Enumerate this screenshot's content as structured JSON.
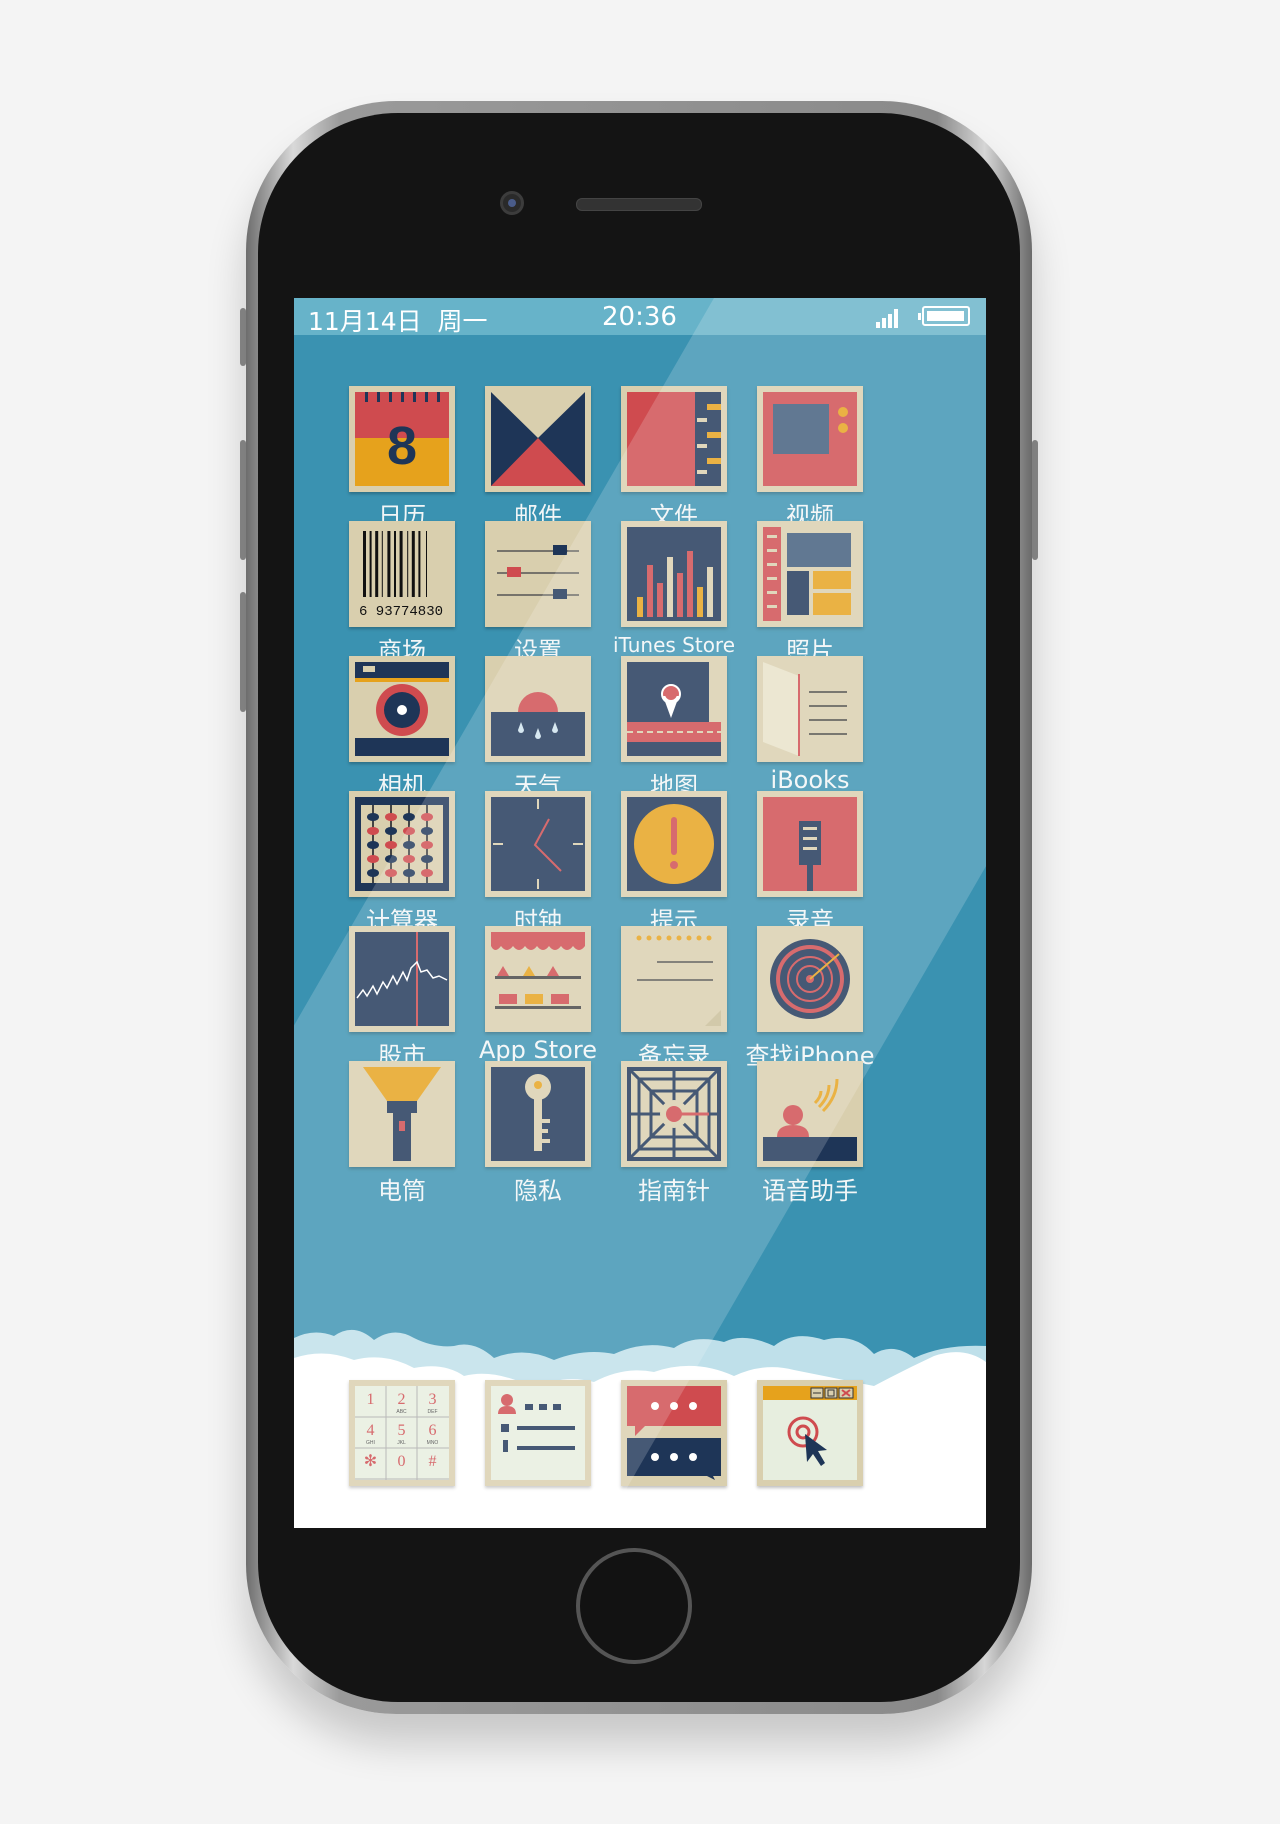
{
  "status_bar": {
    "date": "11月14日",
    "weekday": "周一",
    "time": "20:36",
    "signal_icon": "signal-bars-icon",
    "battery_icon": "battery-icon"
  },
  "apps": [
    {
      "label": "日历",
      "icon": "calendar-icon",
      "calendar_day": "8"
    },
    {
      "label": "邮件",
      "icon": "mail-envelope-icon"
    },
    {
      "label": "文件",
      "icon": "folder-file-icon"
    },
    {
      "label": "视频",
      "icon": "tv-video-icon"
    },
    {
      "label": "商场",
      "icon": "barcode-icon",
      "barcode_number": "6  93774830"
    },
    {
      "label": "设置",
      "icon": "sliders-settings-icon"
    },
    {
      "label": "iTunes Store",
      "icon": "equalizer-bars-icon"
    },
    {
      "label": "照片",
      "icon": "photo-album-icon"
    },
    {
      "label": "相机",
      "icon": "camera-icon"
    },
    {
      "label": "天气",
      "icon": "weather-sun-rain-icon"
    },
    {
      "label": "地图",
      "icon": "map-pin-icon"
    },
    {
      "label": "iBooks",
      "icon": "open-book-icon"
    },
    {
      "label": "计算器",
      "icon": "abacus-icon"
    },
    {
      "label": "时钟",
      "icon": "clock-icon"
    },
    {
      "label": "提示",
      "icon": "exclamation-reminder-icon"
    },
    {
      "label": "录音",
      "icon": "microphone-recorder-icon"
    },
    {
      "label": "股市",
      "icon": "stock-chart-icon"
    },
    {
      "label": "App Store",
      "icon": "storefront-awning-icon"
    },
    {
      "label": "备忘录",
      "icon": "notepad-icon"
    },
    {
      "label": "查找iPhone",
      "icon": "radar-target-icon"
    },
    {
      "label": "电筒",
      "icon": "flashlight-icon"
    },
    {
      "label": "隐私",
      "icon": "key-lock-icon"
    },
    {
      "label": "指南针",
      "icon": "compass-icon"
    },
    {
      "label": "语音助手",
      "icon": "voice-assistant-icon"
    }
  ],
  "dock": [
    {
      "name": "phone-keypad",
      "icon": "dial-keypad-icon",
      "keys": [
        "1",
        "2",
        "3",
        "4",
        "5",
        "6",
        "✻",
        "0",
        "#"
      ],
      "subs": [
        "",
        "ABC",
        "DEF",
        "GHI",
        "JKL",
        "MNO",
        "",
        "",
        ""
      ]
    },
    {
      "name": "contacts",
      "icon": "contacts-list-icon"
    },
    {
      "name": "messages",
      "icon": "message-bubbles-icon"
    },
    {
      "name": "browser",
      "icon": "browser-window-cursor-icon"
    }
  ],
  "colors": {
    "screen_bg": "#3a92b1",
    "status_bar_bg": "#67b3c9",
    "icon_cream": "#d9cfae",
    "navy": "#1e3557",
    "red": "#cf4b4f",
    "orange": "#e6a21c"
  }
}
